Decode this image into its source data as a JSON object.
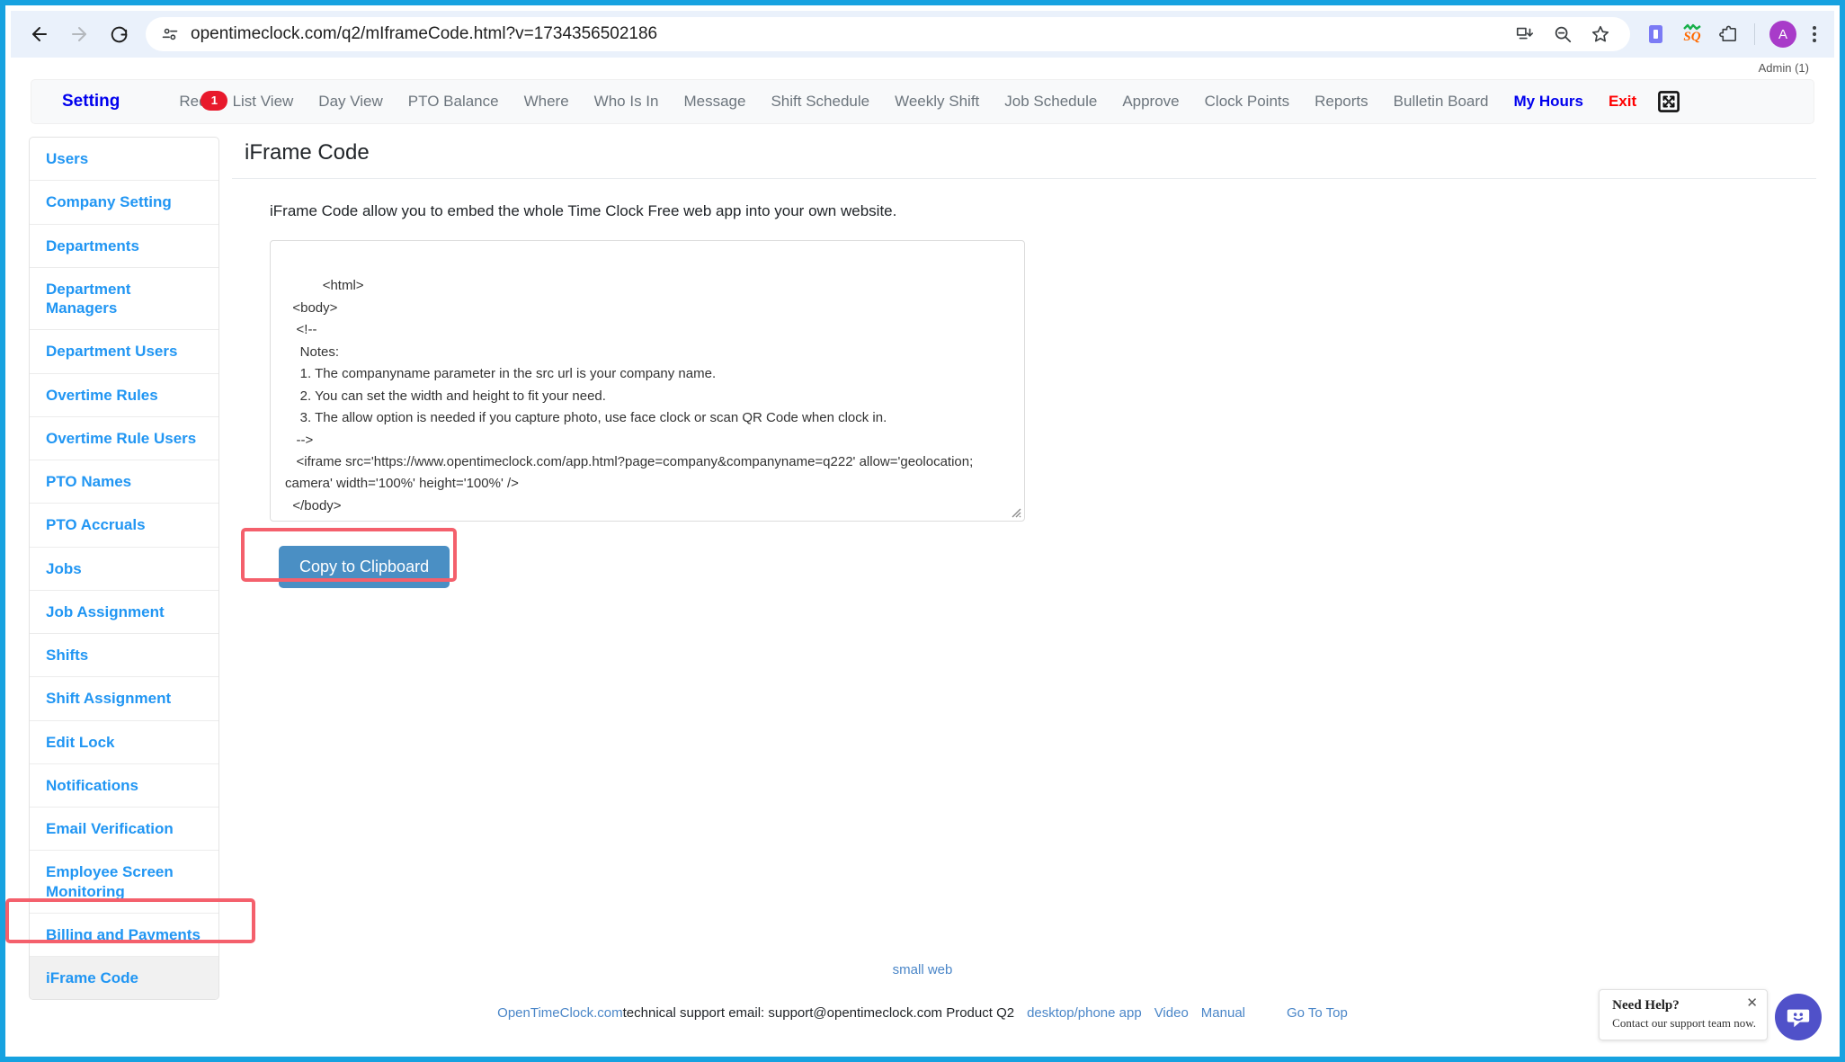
{
  "browser": {
    "url": "opentimeclock.com/q2/mIframeCode.html?v=1734356502186",
    "back_label": "Back",
    "forward_label": "Forward",
    "reload_label": "Reload",
    "profile_initial": "A"
  },
  "header": {
    "admin_label": "Admin (1)"
  },
  "topnav": {
    "brand": "Setting",
    "badge": "1",
    "items": [
      {
        "label": "Req",
        "name": "request",
        "badge": "1"
      },
      {
        "label": "List View",
        "name": "list-view"
      },
      {
        "label": "Day View",
        "name": "day-view"
      },
      {
        "label": "PTO Balance",
        "name": "pto-balance"
      },
      {
        "label": "Where",
        "name": "where"
      },
      {
        "label": "Who Is In",
        "name": "who-is-in"
      },
      {
        "label": "Message",
        "name": "message"
      },
      {
        "label": "Shift Schedule",
        "name": "shift-schedule"
      },
      {
        "label": "Weekly Shift",
        "name": "weekly-shift"
      },
      {
        "label": "Job Schedule",
        "name": "job-schedule"
      },
      {
        "label": "Approve",
        "name": "approve"
      },
      {
        "label": "Clock Points",
        "name": "clock-points"
      },
      {
        "label": "Reports",
        "name": "reports"
      },
      {
        "label": "Bulletin Board",
        "name": "bulletin-board"
      },
      {
        "label": "My Hours",
        "name": "my-hours"
      },
      {
        "label": "Exit",
        "name": "exit"
      }
    ]
  },
  "sidebar": {
    "items": [
      {
        "label": "Users"
      },
      {
        "label": "Company Setting"
      },
      {
        "label": "Departments"
      },
      {
        "label": "Department Managers"
      },
      {
        "label": "Department Users"
      },
      {
        "label": "Overtime Rules"
      },
      {
        "label": "Overtime Rule Users"
      },
      {
        "label": "PTO Names"
      },
      {
        "label": "PTO Accruals"
      },
      {
        "label": "Jobs"
      },
      {
        "label": "Job Assignment"
      },
      {
        "label": "Shifts"
      },
      {
        "label": "Shift Assignment"
      },
      {
        "label": "Edit Lock"
      },
      {
        "label": "Notifications"
      },
      {
        "label": "Email Verification"
      },
      {
        "label": "Employee Screen Monitoring"
      },
      {
        "label": "Billing and Payments"
      },
      {
        "label": "iFrame Code"
      }
    ],
    "active": "iFrame Code"
  },
  "main": {
    "title": "iFrame Code",
    "description": "iFrame Code allow you to embed the whole Time Clock Free web app into your own website.",
    "code": "<html>\n  <body>\n   <!--\n    Notes:\n    1. The companyname parameter in the src url is your company name.\n    2. You can set the width and height to fit your need.\n    3. The allow option is needed if you capture photo, use face clock or scan QR Code when clock in.\n   -->\n   <iframe src='https://www.opentimeclock.com/app.html?page=company&companyname=q222' allow='geolocation; camera' width='100%' height='100%' />\n  </body>\n</html>",
    "copy_button": "Copy to Clipboard"
  },
  "footer": {
    "small_web": "small web",
    "brand_link": "OpenTimeClock.com",
    "support_text": " technical support email: support@opentimeclock.com Product Q2",
    "desktop_phone_app": "desktop/phone app",
    "video": "Video",
    "manual": "Manual",
    "go_to_top": "Go To Top"
  },
  "chat": {
    "title": "Need Help?",
    "subtitle": "Contact our support team now.",
    "close": "✕"
  },
  "colors": {
    "frame": "#17a2e0",
    "link": "#2196f3",
    "brand": "#0000ee",
    "exit": "#ff0000",
    "badge": "#e8192c",
    "button": "#4a8fc4",
    "highlight": "#f4606c"
  }
}
